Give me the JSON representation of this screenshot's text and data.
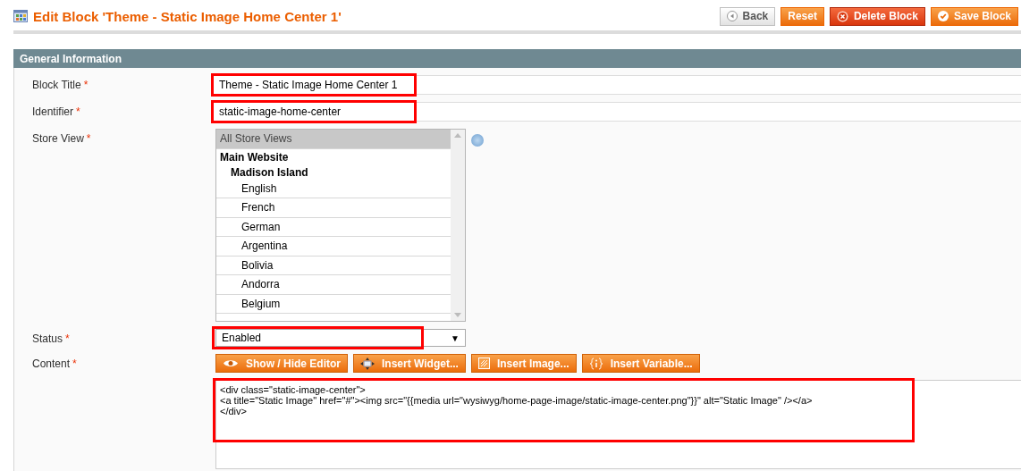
{
  "page_title": "Edit Block 'Theme - Static Image Home Center 1'",
  "actions": [
    {
      "kind": "back",
      "label": "Back"
    },
    {
      "kind": "reset",
      "label": "Reset"
    },
    {
      "kind": "delete",
      "label": "Delete Block"
    },
    {
      "kind": "save",
      "label": "Save Block"
    }
  ],
  "section": {
    "title": "General Information"
  },
  "fields": {
    "block_title": {
      "label": "Block Title",
      "required_mark": "*",
      "value": "Theme - Static Image Home Center 1",
      "highlighted": true
    },
    "identifier": {
      "label": "Identifier",
      "required_mark": "*",
      "value": "static-image-home-center",
      "highlighted": true
    },
    "store_view": {
      "label": "Store View",
      "required_mark": "*",
      "highlighted": false,
      "options": [
        {
          "kind": "option",
          "label": "All Store Views",
          "selected": true
        },
        {
          "kind": "group",
          "label": "Main Website",
          "children": [
            {
              "kind": "group",
              "label": "Madison Island",
              "children": [
                {
                  "kind": "option",
                  "label": "English",
                  "selected": false
                },
                {
                  "kind": "option",
                  "label": "French",
                  "selected": false
                },
                {
                  "kind": "option",
                  "label": "German",
                  "selected": false
                },
                {
                  "kind": "option",
                  "label": "Argentina",
                  "selected": false
                },
                {
                  "kind": "option",
                  "label": "Bolivia",
                  "selected": false
                },
                {
                  "kind": "option",
                  "label": "Andorra",
                  "selected": false
                },
                {
                  "kind": "option",
                  "label": "Belgium",
                  "selected": false
                }
              ]
            }
          ]
        }
      ]
    },
    "status": {
      "label": "Status",
      "required_mark": "*",
      "value": "Enabled",
      "arrow": "▼",
      "highlighted": true
    },
    "content": {
      "label": "Content",
      "required_mark": "*",
      "highlighted": true,
      "tools": [
        {
          "kind": "editor",
          "label": "Show / Hide Editor"
        },
        {
          "kind": "widget",
          "label": "Insert Widget..."
        },
        {
          "kind": "image",
          "label": "Insert Image..."
        },
        {
          "kind": "variable",
          "label": "Insert Variable..."
        }
      ],
      "lines": [
        "<div class=\"static-image-center\">",
        "<a title=\"Static Image\" href=\"#\"><img src=\"{{media url=\"wysiwyg/home-page-image/static-image-center.png\"}}\" alt=\"Static Image\" /></a>",
        "</div>"
      ]
    }
  }
}
